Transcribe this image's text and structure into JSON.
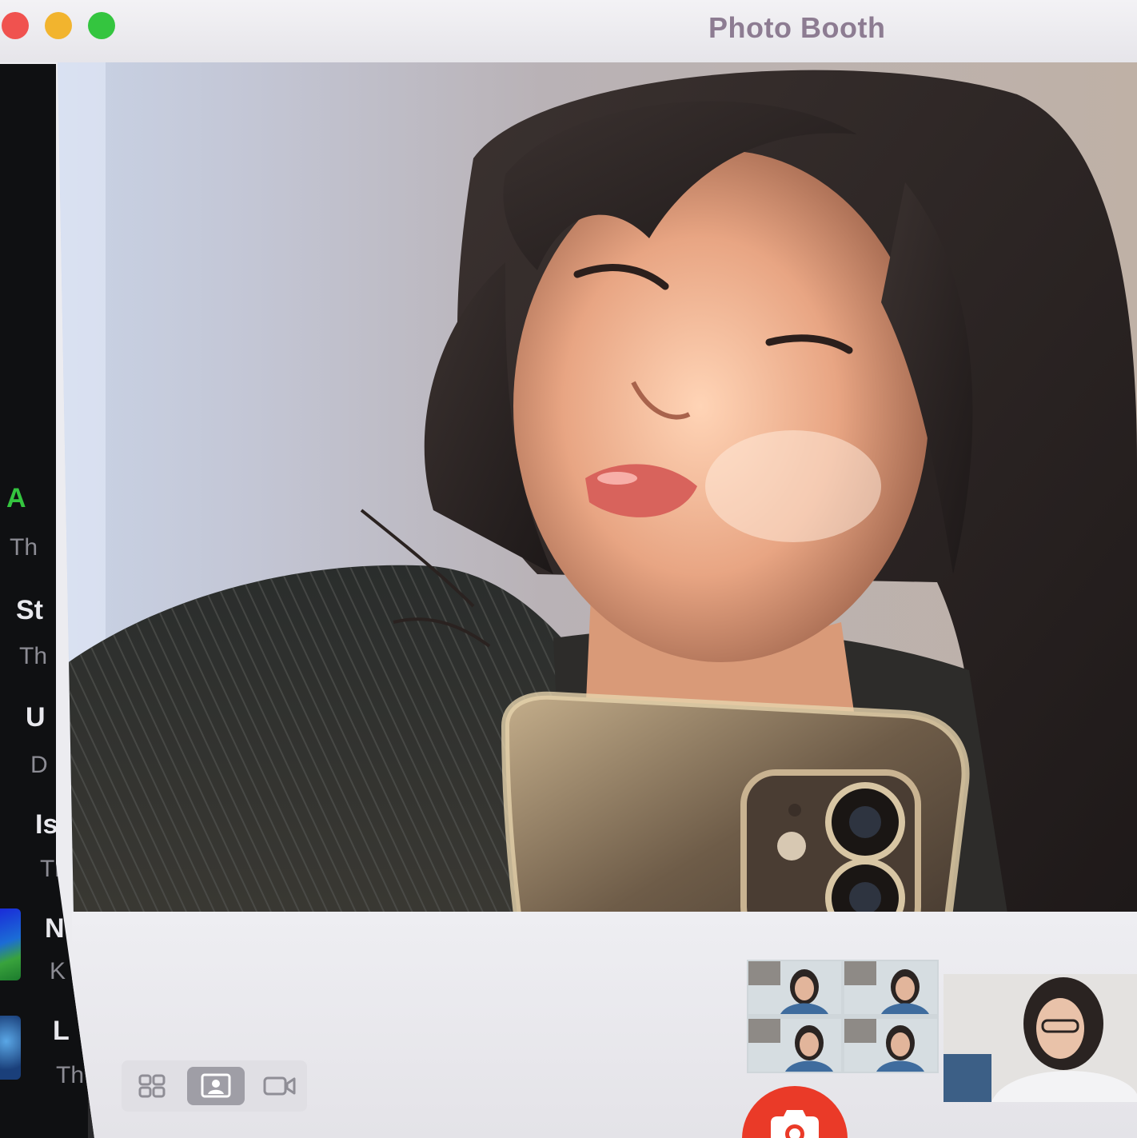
{
  "window": {
    "title": "Photo Booth",
    "controls": [
      "close",
      "minimize",
      "zoom"
    ],
    "colors": {
      "close": "#f0524f",
      "minimize": "#f2b42e",
      "zoom": "#34c53f"
    }
  },
  "background_list": [
    {
      "title": "A",
      "sub": "Th",
      "title_color": "#34c53f"
    },
    {
      "title": "St",
      "sub": "Th"
    },
    {
      "title": "U",
      "sub": "D"
    },
    {
      "title": "Is",
      "sub": "Th"
    },
    {
      "title": "N",
      "sub": "K"
    },
    {
      "title": "L",
      "sub": "Th"
    }
  ],
  "toolbar": {
    "modes": [
      {
        "name": "grid-view",
        "icon": "four-up-grid-icon",
        "active": false
      },
      {
        "name": "single-photo",
        "icon": "portrait-photo-icon",
        "active": true
      },
      {
        "name": "video",
        "icon": "video-camera-icon",
        "active": false
      }
    ],
    "shutter": {
      "icon": "camera-icon",
      "color": "#ea3a28"
    }
  },
  "thumbnails": [
    {
      "type": "four-up-strip",
      "frames": 4
    },
    {
      "type": "single-photo"
    }
  ]
}
